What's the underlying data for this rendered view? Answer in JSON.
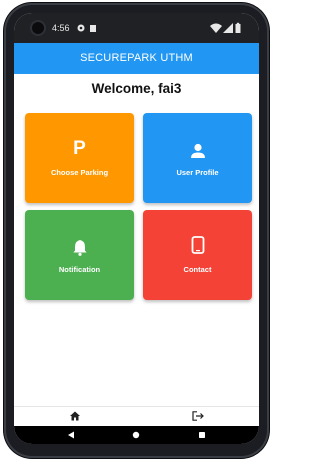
{
  "status_bar": {
    "time": "4:56",
    "icons": [
      "camera-icon",
      "settings-dot-icon",
      "sim-icon",
      "wifi-icon",
      "signal-icon",
      "battery-icon"
    ]
  },
  "app_bar": {
    "title": "SECUREPARK UTHM",
    "color": "#2196f3"
  },
  "welcome": "Welcome, fai3",
  "tiles": [
    {
      "label": "Choose Parking",
      "glyph": "P",
      "icon": "parking-icon",
      "color": "#ff9800"
    },
    {
      "label": "User Profile",
      "icon": "person-icon",
      "color": "#2196f3"
    },
    {
      "label": "Notification",
      "icon": "bell-icon",
      "color": "#4caf50"
    },
    {
      "label": "Contact",
      "icon": "phone-icon",
      "color": "#f44336"
    }
  ],
  "bottom_nav": [
    {
      "icon": "home-icon"
    },
    {
      "icon": "logout-icon"
    }
  ],
  "android_nav": [
    "back-icon",
    "home-circle-icon",
    "recents-icon"
  ]
}
